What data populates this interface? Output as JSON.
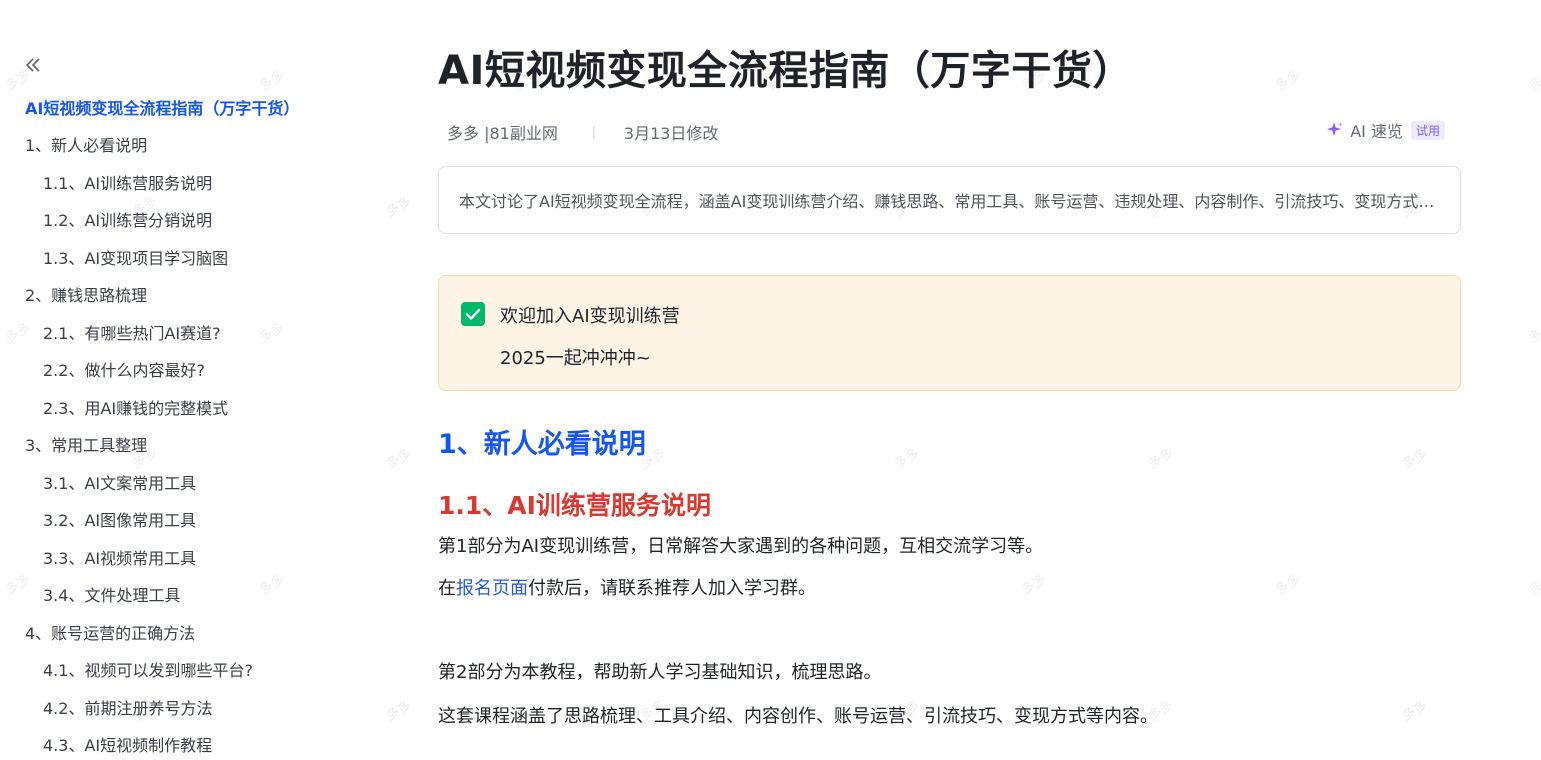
{
  "watermark": {
    "text": "多多"
  },
  "sidebar": {
    "toc": [
      {
        "label": "AI短视频变现全流程指南（万字干货）",
        "level": 0,
        "active": true
      },
      {
        "label": "1、新人必看说明",
        "level": 0
      },
      {
        "label": "1.1、AI训练营服务说明",
        "level": 1
      },
      {
        "label": "1.2、AI训练营分销说明",
        "level": 1
      },
      {
        "label": "1.3、AI变现项目学习脑图",
        "level": 1
      },
      {
        "label": "2、赚钱思路梳理",
        "level": 0
      },
      {
        "label": "2.1、有哪些热门AI赛道?",
        "level": 1
      },
      {
        "label": "2.2、做什么内容最好?",
        "level": 1
      },
      {
        "label": "2.3、用AI赚钱的完整模式",
        "level": 1
      },
      {
        "label": "3、常用工具整理",
        "level": 0
      },
      {
        "label": "3.1、AI文案常用工具",
        "level": 1
      },
      {
        "label": "3.2、AI图像常用工具",
        "level": 1
      },
      {
        "label": "3.3、AI视频常用工具",
        "level": 1
      },
      {
        "label": "3.4、文件处理工具",
        "level": 1
      },
      {
        "label": "4、账号运营的正确方法",
        "level": 0
      },
      {
        "label": "4.1、视频可以发到哪些平台?",
        "level": 1
      },
      {
        "label": "4.2、前期注册养号方法",
        "level": 1
      },
      {
        "label": "4.3、AI短视频制作教程",
        "level": 1
      }
    ]
  },
  "doc": {
    "title": "AI短视频变现全流程指南（万字干货）",
    "author": "多多 |81副业网",
    "modified": "3月13日修改",
    "ai_quick_label": "AI 速览",
    "ai_quick_badge": "试用",
    "summary": "本文讨论了AI短视频变现全流程，涵盖AI变现训练营介绍、赚钱思路、常用工具、账号运营、违规处理、内容制作、引流技巧、变现方式等内容。",
    "callout": {
      "line1": "欢迎加入AI变现训练营",
      "line2": "2025一起冲冲冲~",
      "checked": true
    },
    "heading1": "1、新人必看说明",
    "heading2": "1.1、AI训练营服务说明",
    "para1": "第1部分为AI变现训练营，日常解答大家遇到的各种问题，互相交流学习等。",
    "para2_prefix": "在",
    "para2_link": "报名页面",
    "para2_suffix": "付款后，请联系推荐人加入学习群。",
    "para3": "第2部分为本教程，帮助新人学习基础知识，梳理思路。",
    "para4": "这套课程涵盖了思路梳理、工具介绍、内容创作、账号运营、引流技巧、变现方式等内容。"
  },
  "colors": {
    "accent_blue": "#1456f0",
    "heading_red": "#d83931",
    "callout_bg": "#fef4e6",
    "check_green": "#00b96b"
  }
}
